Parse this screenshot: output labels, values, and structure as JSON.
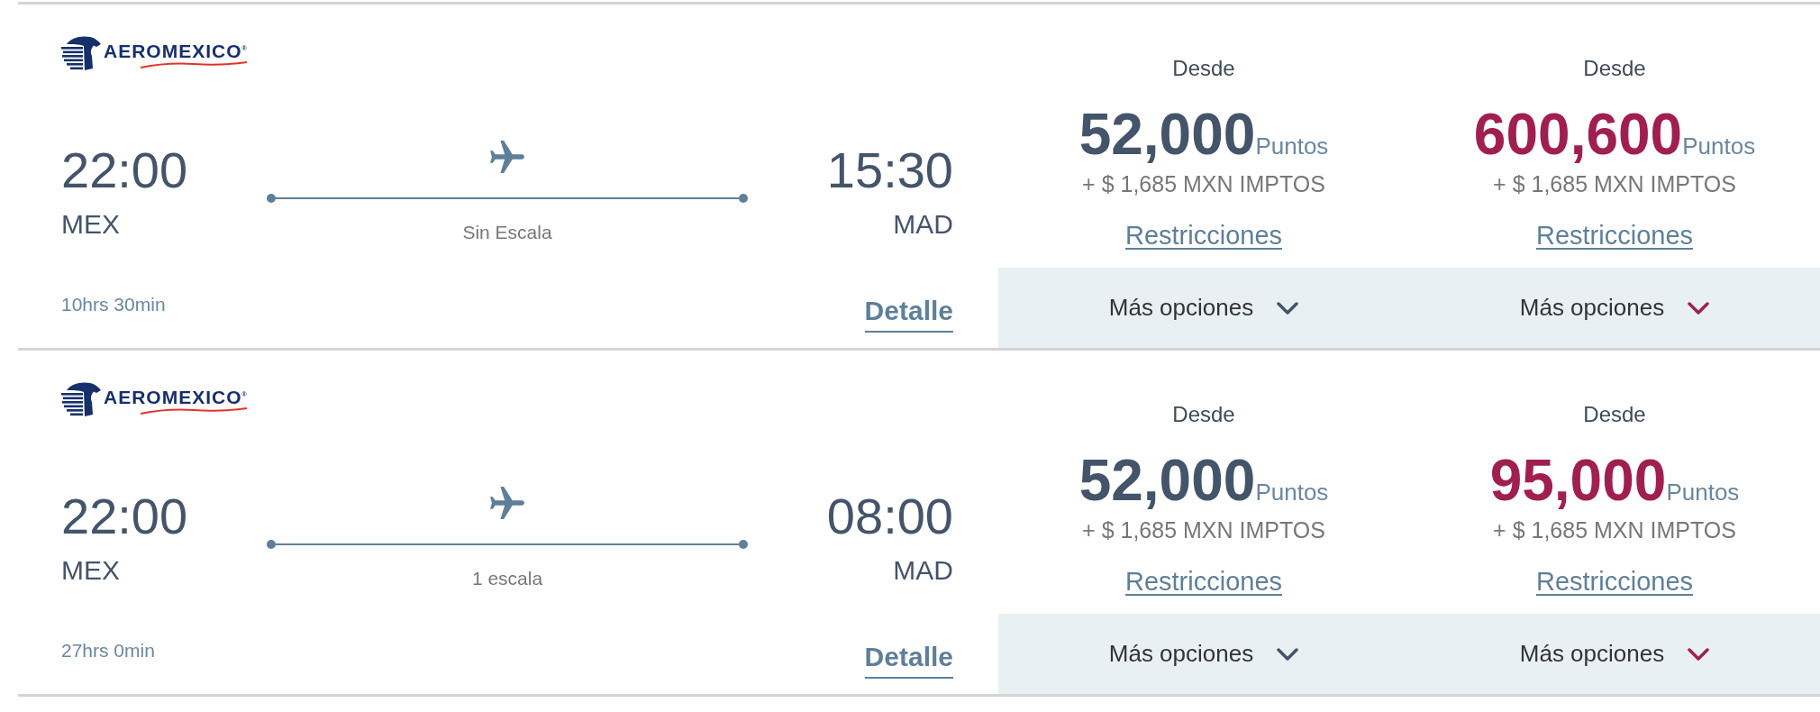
{
  "flights": [
    {
      "airline": "AEROMEXICO$^{®}$",
      "departure": {
        "time": "22:00",
        "airport": "MEX"
      },
      "stops": "Sin Escala",
      "arrival": {
        "time": "15:30",
        "airport": "MAD"
      },
      "duration": "10hrs 30min",
      "details_link": "Detalle",
      "fares": [
        {
          "label": "Desde",
          "points": "52,000",
          "unit": "Puntos",
          "taxes": "+ $ 1,685 MXN IMPTOS",
          "restrictions": "Restricciones",
          "more_options": "Más opciones",
          "expanded": false,
          "color": "#44546a"
        },
        {
          "label": "Desde",
          "points": "600,600",
          "unit": "Puntos",
          "taxes": "+ $ 1,685 MXN IMPTOS",
          "restrictions": "Restricciones",
          "more_options": "Más opciones",
          "expanded": false,
          "color": "#a01f50"
        }
      ]
    },
    {
      "airline": "AEROMEXICO$^{®}$",
      "departure": {
        "time": "22:00",
        "airport": "MEX"
      },
      "stops": "1 escala",
      "arrival": {
        "time": "08:00",
        "airport": "MAD"
      },
      "duration": "27hrs 0min",
      "details_link": "Detalle",
      "fares": [
        {
          "label": "Desde",
          "points": "52,000",
          "unit": "Puntos",
          "taxes": "+ $ 1,685 MXN IMPTOS",
          "restrictions": "Restricciones",
          "more_options": "Más opciones",
          "expanded": false,
          "color": "#44546a"
        },
        {
          "label": "Desde",
          "points": "95,000",
          "unit": "Puntos",
          "taxes": "+ $ 1,685 MXN IMPTOS",
          "restrictions": "Restricciones",
          "more_options": "Más opciones",
          "expanded": false,
          "color": "#a01f50"
        }
      ]
    }
  ]
}
